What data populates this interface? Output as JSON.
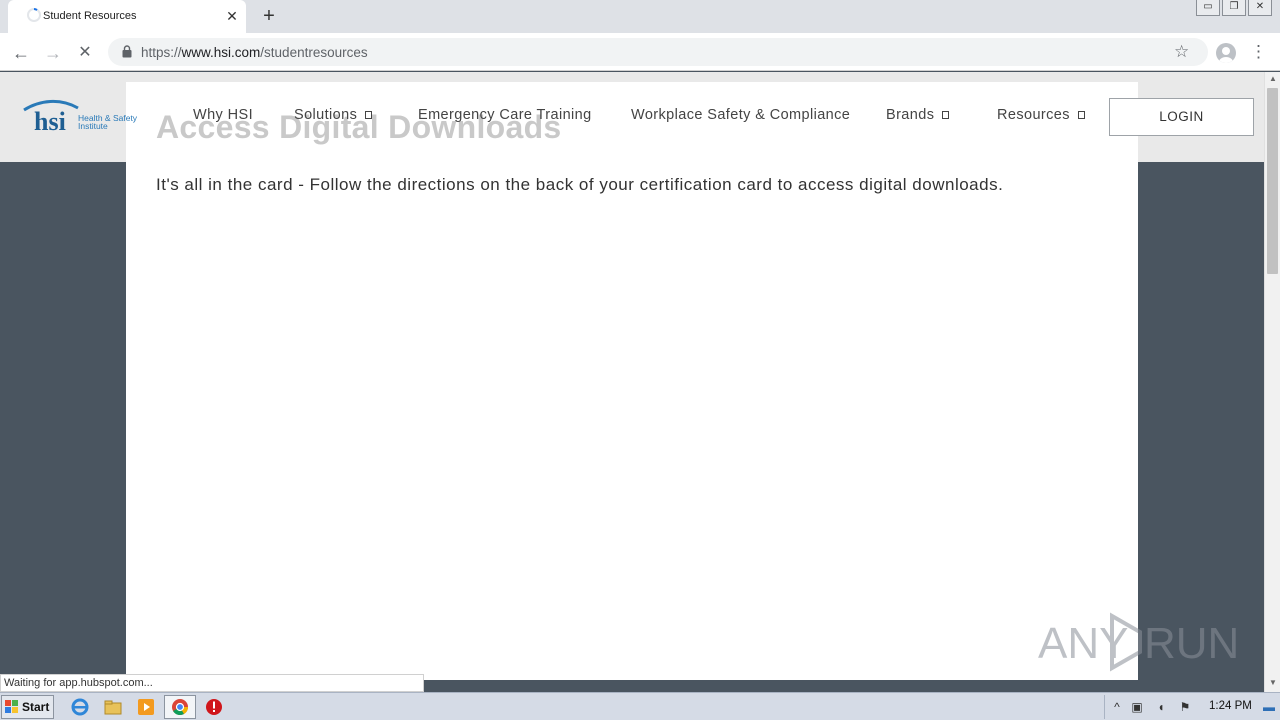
{
  "browser": {
    "tab_title": "Student Resources",
    "tab_close": "✕",
    "new_tab": "+",
    "window_controls": [
      "▭",
      "❐",
      "✕"
    ],
    "url_scheme": "https://",
    "url_host": "www.hsi.com",
    "url_path": "/studentresources",
    "back": "←",
    "forward": "→",
    "reload": "✕",
    "star": "☆",
    "menu": "⋮"
  },
  "site": {
    "logo_text": "hsi",
    "logo_sub1": "Health & Safety",
    "logo_sub2": "Institute",
    "nav": [
      {
        "label": "Why HSI"
      },
      {
        "label": "Solutions"
      },
      {
        "label": "Emergency Care Training"
      },
      {
        "label": "Workplace Safety & Compliance"
      },
      {
        "label": "Brands"
      },
      {
        "label": "Resources"
      }
    ],
    "login": "LOGIN"
  },
  "main": {
    "heading": "Access Digital Downloads",
    "body": "It's all in the card - Follow the directions on the back of your certification card to access digital downloads."
  },
  "status_text": "Waiting for app.hubspot.com...",
  "watermark": {
    "left": "ANY",
    "right": "RUN"
  },
  "taskbar": {
    "start": "Start",
    "clock": "1:24 PM"
  },
  "colors": {
    "brand_blue": "#2a7ab8",
    "page_dark": "#4a5560"
  }
}
